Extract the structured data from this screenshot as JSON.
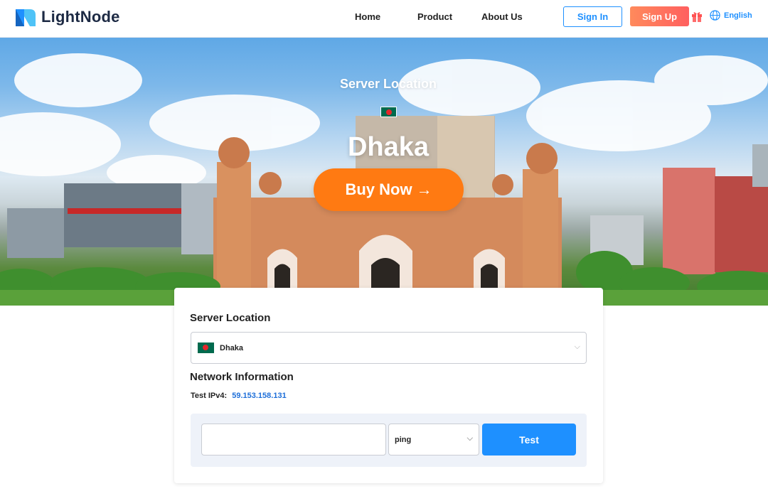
{
  "header": {
    "brand": "LightNode",
    "nav": [
      "Home",
      "Product",
      "About Us"
    ],
    "sign_in": "Sign In",
    "sign_up": "Sign Up",
    "language": "English"
  },
  "hero": {
    "subtitle": "Server Location",
    "city": "Dhaka",
    "buy_label": "Buy Now",
    "arrow": "→"
  },
  "card": {
    "location_title": "Server Location",
    "location_value": "Dhaka",
    "network_title": "Network Information",
    "ipv4_label": "Test IPv4:",
    "ipv4_value": "59.153.158.131",
    "host_placeholder": "",
    "method_value": "ping",
    "test_label": "Test"
  },
  "colors": {
    "accent_blue": "#1e90ff",
    "buy_orange": "#ff7a12",
    "flag_green": "#006a4e",
    "flag_red": "#e4262b"
  }
}
